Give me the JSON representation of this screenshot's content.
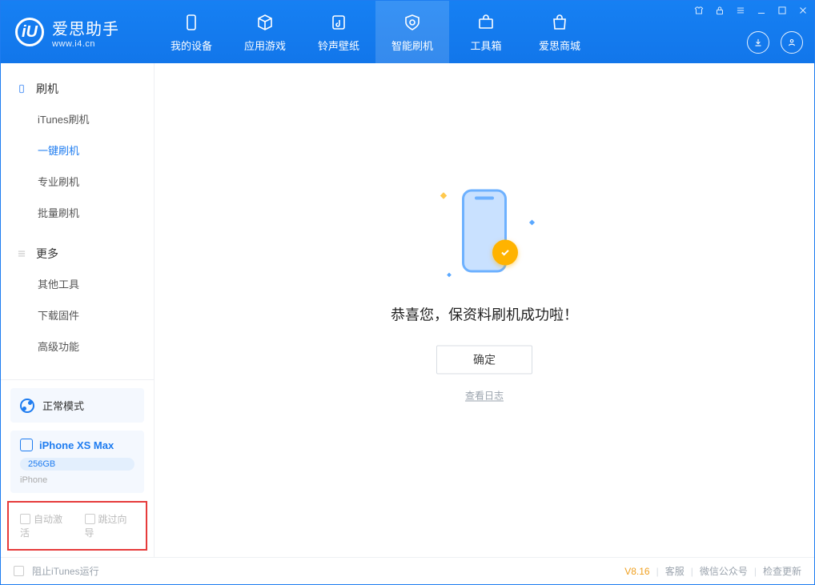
{
  "app": {
    "name": "爱思助手",
    "url": "www.i4.cn"
  },
  "tabs": [
    {
      "label": "我的设备"
    },
    {
      "label": "应用游戏"
    },
    {
      "label": "铃声壁纸"
    },
    {
      "label": "智能刷机"
    },
    {
      "label": "工具箱"
    },
    {
      "label": "爱思商城"
    }
  ],
  "sidebar": {
    "group1_title": "刷机",
    "group1_items": [
      {
        "label": "iTunes刷机"
      },
      {
        "label": "一键刷机"
      },
      {
        "label": "专业刷机"
      },
      {
        "label": "批量刷机"
      }
    ],
    "group2_title": "更多",
    "group2_items": [
      {
        "label": "其他工具"
      },
      {
        "label": "下载固件"
      },
      {
        "label": "高级功能"
      }
    ],
    "mode_label": "正常模式",
    "device_name": "iPhone XS Max",
    "device_storage": "256GB",
    "device_type": "iPhone",
    "check1": "自动激活",
    "check2": "跳过向导"
  },
  "main": {
    "success_msg": "恭喜您，保资料刷机成功啦！",
    "ok_btn": "确定",
    "log_link": "查看日志"
  },
  "footer": {
    "block_itunes": "阻止iTunes运行",
    "version": "V8.16",
    "links": [
      "客服",
      "微信公众号",
      "检查更新"
    ]
  }
}
